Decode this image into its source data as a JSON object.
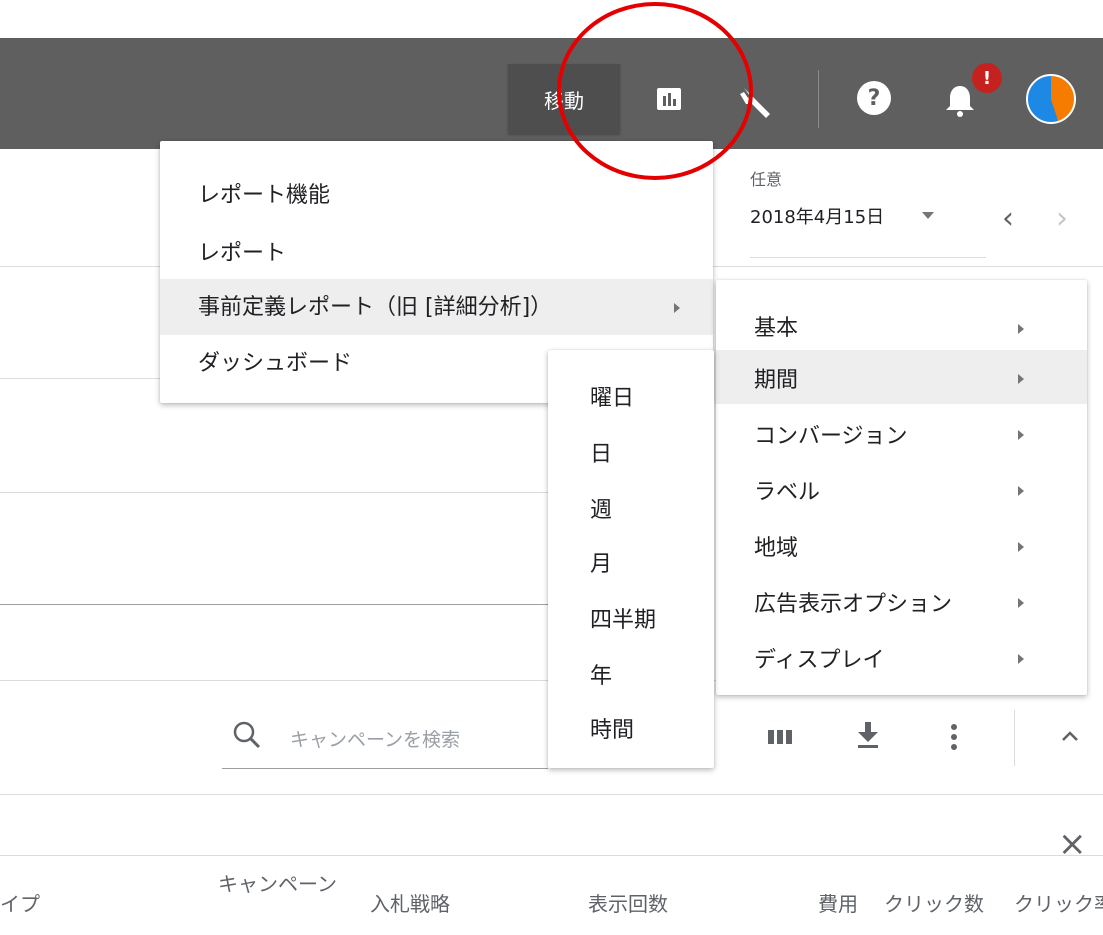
{
  "topbar": {
    "goto_label": "移動",
    "reports_icon": "bar-chart-icon",
    "tools_icon": "wrench-icon",
    "help_icon": "help-icon",
    "help_glyph": "?",
    "notification_icon": "bell-icon",
    "notification_badge": "!",
    "avatar_icon": "account-avatar"
  },
  "date": {
    "label": "任意",
    "value": "2018年4月15日",
    "prev_glyph": "‹",
    "next_glyph": "›"
  },
  "reports_menu": {
    "items": [
      {
        "label": "レポート機能"
      },
      {
        "label": "レポート"
      },
      {
        "label": "事前定義レポート（旧 [詳細分析]）",
        "has_submenu": true,
        "highlighted": true
      },
      {
        "label": "ダッシュボード"
      }
    ]
  },
  "predefined_menu": {
    "items": [
      {
        "label": "基本"
      },
      {
        "label": "期間",
        "highlighted": true
      },
      {
        "label": "コンバージョン"
      },
      {
        "label": "ラベル"
      },
      {
        "label": "地域"
      },
      {
        "label": "広告表示オプション"
      },
      {
        "label": "ディスプレイ"
      }
    ]
  },
  "period_menu": {
    "items": [
      {
        "label": "曜日"
      },
      {
        "label": "日"
      },
      {
        "label": "週"
      },
      {
        "label": "月"
      },
      {
        "label": "四半期"
      },
      {
        "label": "年"
      },
      {
        "label": "時間"
      }
    ]
  },
  "toolbar": {
    "search_placeholder": "キャンペーンを検索",
    "columns_icon": "columns-icon",
    "download_icon": "download-icon",
    "more_icon": "more-vert-icon",
    "collapse_icon": "chevron-up-icon"
  },
  "filter_bar": {
    "close_glyph": "×"
  },
  "table": {
    "headers": [
      "イプ",
      "キャンペーン",
      "入札戦略",
      "表示回数",
      "費用",
      "クリック数",
      "クリック率"
    ]
  },
  "colors": {
    "topbar": "#5f5f5f",
    "goto_button": "#4e4e4e",
    "menu_highlight": "#eeeeee",
    "notification_badge": "#c5221f",
    "annotation_circle": "#e40000"
  }
}
